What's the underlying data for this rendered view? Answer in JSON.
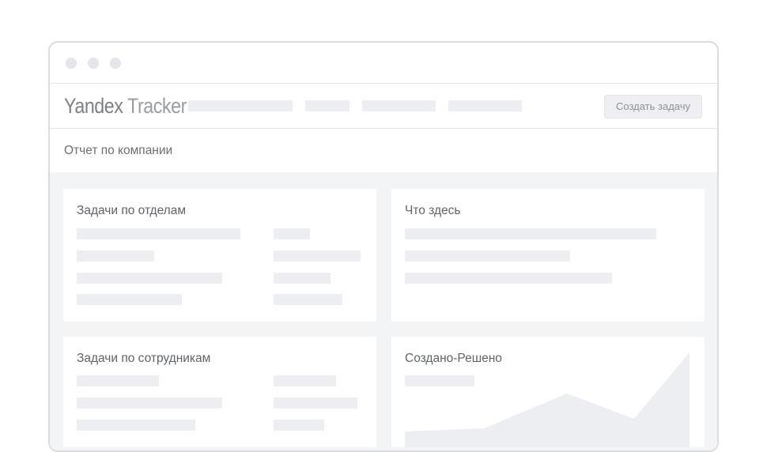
{
  "app": {
    "brand": "Yandex",
    "product": "Tracker"
  },
  "header": {
    "create_button": "Создать задачу"
  },
  "page": {
    "title": "Отчет по компании"
  },
  "widgets": {
    "by_department": {
      "title": "Задачи по отделам"
    },
    "what_here": {
      "title": "Что здесь"
    },
    "by_employee": {
      "title": "Задачи по сотрудникам"
    },
    "created_resolved": {
      "title": "Создано-Решено"
    }
  },
  "colors": {
    "placeholder": "#eceef1",
    "background": "#f3f4f6",
    "border": "#dcdde0"
  }
}
